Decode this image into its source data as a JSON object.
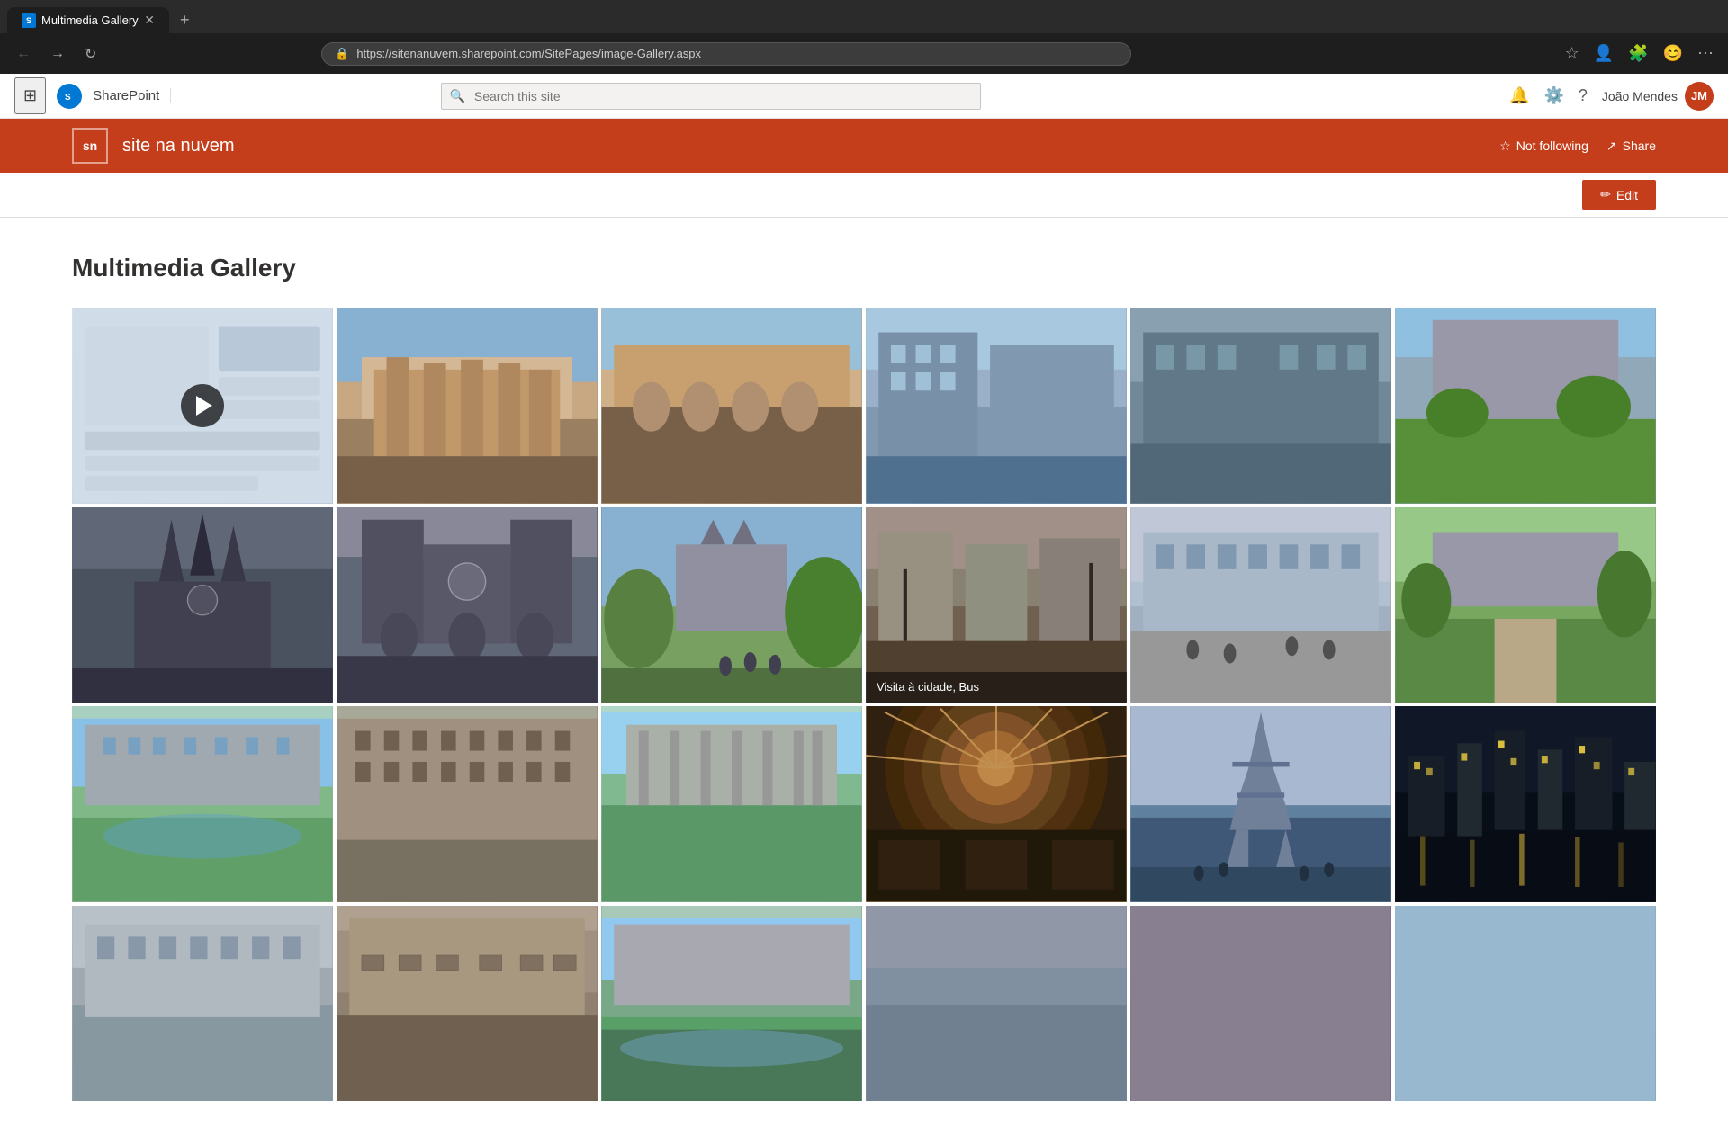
{
  "browser": {
    "tab_title": "Multimedia Gallery",
    "tab_favicon": "S",
    "url": "https://sitenanuvem.sharepoint.com/SitePages/image-Gallery.aspx",
    "new_tab_label": "+"
  },
  "sp_header": {
    "brand": "SharePoint",
    "search_placeholder": "Search this site",
    "user_name": "João Mendes",
    "user_initials": "JM"
  },
  "site_header": {
    "logo_text": "sn",
    "site_name": "site na nuvem",
    "not_following_label": "Not following",
    "share_label": "Share"
  },
  "page_actions": {
    "edit_label": "Edit"
  },
  "page": {
    "title": "Multimedia Gallery"
  },
  "gallery": {
    "caption_row2_col4": "Visita à cidade, Bus"
  }
}
